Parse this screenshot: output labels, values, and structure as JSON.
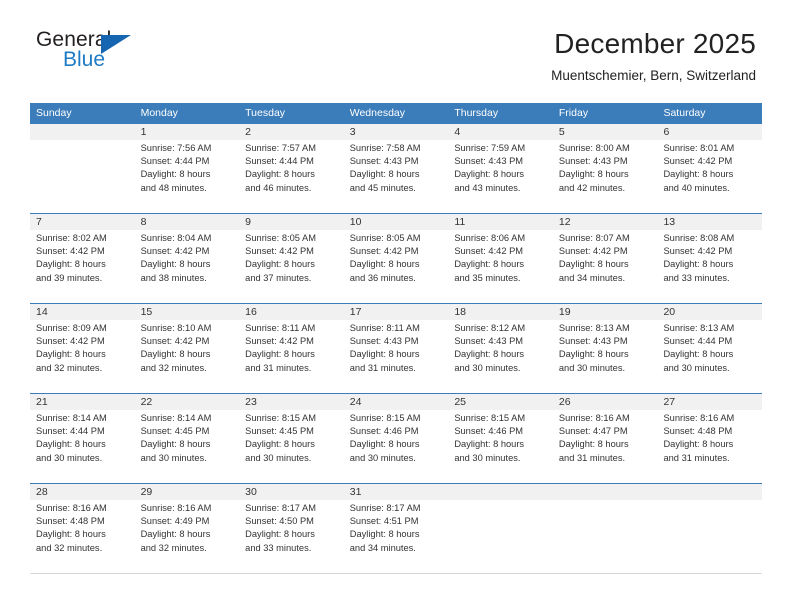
{
  "logo": {
    "primary_text": "General",
    "secondary_text": "Blue",
    "triangle_color": "#1565b0",
    "secondary_color": "#1f7bc4"
  },
  "header": {
    "title": "December 2025",
    "subtitle": "Muentschemier, Bern, Switzerland"
  },
  "theme": {
    "header_blue": "#3b7cba",
    "daynum_band": "#f1f1f1",
    "text": "#333333"
  },
  "calendar": {
    "weekdays": [
      "Sunday",
      "Monday",
      "Tuesday",
      "Wednesday",
      "Thursday",
      "Friday",
      "Saturday"
    ],
    "weeks": [
      [
        {
          "day": "",
          "sunrise": "",
          "sunset": "",
          "daylight_line1": "",
          "daylight_line2": ""
        },
        {
          "day": "1",
          "sunrise": "Sunrise: 7:56 AM",
          "sunset": "Sunset: 4:44 PM",
          "daylight_line1": "Daylight: 8 hours",
          "daylight_line2": "and 48 minutes."
        },
        {
          "day": "2",
          "sunrise": "Sunrise: 7:57 AM",
          "sunset": "Sunset: 4:44 PM",
          "daylight_line1": "Daylight: 8 hours",
          "daylight_line2": "and 46 minutes."
        },
        {
          "day": "3",
          "sunrise": "Sunrise: 7:58 AM",
          "sunset": "Sunset: 4:43 PM",
          "daylight_line1": "Daylight: 8 hours",
          "daylight_line2": "and 45 minutes."
        },
        {
          "day": "4",
          "sunrise": "Sunrise: 7:59 AM",
          "sunset": "Sunset: 4:43 PM",
          "daylight_line1": "Daylight: 8 hours",
          "daylight_line2": "and 43 minutes."
        },
        {
          "day": "5",
          "sunrise": "Sunrise: 8:00 AM",
          "sunset": "Sunset: 4:43 PM",
          "daylight_line1": "Daylight: 8 hours",
          "daylight_line2": "and 42 minutes."
        },
        {
          "day": "6",
          "sunrise": "Sunrise: 8:01 AM",
          "sunset": "Sunset: 4:42 PM",
          "daylight_line1": "Daylight: 8 hours",
          "daylight_line2": "and 40 minutes."
        }
      ],
      [
        {
          "day": "7",
          "sunrise": "Sunrise: 8:02 AM",
          "sunset": "Sunset: 4:42 PM",
          "daylight_line1": "Daylight: 8 hours",
          "daylight_line2": "and 39 minutes."
        },
        {
          "day": "8",
          "sunrise": "Sunrise: 8:04 AM",
          "sunset": "Sunset: 4:42 PM",
          "daylight_line1": "Daylight: 8 hours",
          "daylight_line2": "and 38 minutes."
        },
        {
          "day": "9",
          "sunrise": "Sunrise: 8:05 AM",
          "sunset": "Sunset: 4:42 PM",
          "daylight_line1": "Daylight: 8 hours",
          "daylight_line2": "and 37 minutes."
        },
        {
          "day": "10",
          "sunrise": "Sunrise: 8:05 AM",
          "sunset": "Sunset: 4:42 PM",
          "daylight_line1": "Daylight: 8 hours",
          "daylight_line2": "and 36 minutes."
        },
        {
          "day": "11",
          "sunrise": "Sunrise: 8:06 AM",
          "sunset": "Sunset: 4:42 PM",
          "daylight_line1": "Daylight: 8 hours",
          "daylight_line2": "and 35 minutes."
        },
        {
          "day": "12",
          "sunrise": "Sunrise: 8:07 AM",
          "sunset": "Sunset: 4:42 PM",
          "daylight_line1": "Daylight: 8 hours",
          "daylight_line2": "and 34 minutes."
        },
        {
          "day": "13",
          "sunrise": "Sunrise: 8:08 AM",
          "sunset": "Sunset: 4:42 PM",
          "daylight_line1": "Daylight: 8 hours",
          "daylight_line2": "and 33 minutes."
        }
      ],
      [
        {
          "day": "14",
          "sunrise": "Sunrise: 8:09 AM",
          "sunset": "Sunset: 4:42 PM",
          "daylight_line1": "Daylight: 8 hours",
          "daylight_line2": "and 32 minutes."
        },
        {
          "day": "15",
          "sunrise": "Sunrise: 8:10 AM",
          "sunset": "Sunset: 4:42 PM",
          "daylight_line1": "Daylight: 8 hours",
          "daylight_line2": "and 32 minutes."
        },
        {
          "day": "16",
          "sunrise": "Sunrise: 8:11 AM",
          "sunset": "Sunset: 4:42 PM",
          "daylight_line1": "Daylight: 8 hours",
          "daylight_line2": "and 31 minutes."
        },
        {
          "day": "17",
          "sunrise": "Sunrise: 8:11 AM",
          "sunset": "Sunset: 4:43 PM",
          "daylight_line1": "Daylight: 8 hours",
          "daylight_line2": "and 31 minutes."
        },
        {
          "day": "18",
          "sunrise": "Sunrise: 8:12 AM",
          "sunset": "Sunset: 4:43 PM",
          "daylight_line1": "Daylight: 8 hours",
          "daylight_line2": "and 30 minutes."
        },
        {
          "day": "19",
          "sunrise": "Sunrise: 8:13 AM",
          "sunset": "Sunset: 4:43 PM",
          "daylight_line1": "Daylight: 8 hours",
          "daylight_line2": "and 30 minutes."
        },
        {
          "day": "20",
          "sunrise": "Sunrise: 8:13 AM",
          "sunset": "Sunset: 4:44 PM",
          "daylight_line1": "Daylight: 8 hours",
          "daylight_line2": "and 30 minutes."
        }
      ],
      [
        {
          "day": "21",
          "sunrise": "Sunrise: 8:14 AM",
          "sunset": "Sunset: 4:44 PM",
          "daylight_line1": "Daylight: 8 hours",
          "daylight_line2": "and 30 minutes."
        },
        {
          "day": "22",
          "sunrise": "Sunrise: 8:14 AM",
          "sunset": "Sunset: 4:45 PM",
          "daylight_line1": "Daylight: 8 hours",
          "daylight_line2": "and 30 minutes."
        },
        {
          "day": "23",
          "sunrise": "Sunrise: 8:15 AM",
          "sunset": "Sunset: 4:45 PM",
          "daylight_line1": "Daylight: 8 hours",
          "daylight_line2": "and 30 minutes."
        },
        {
          "day": "24",
          "sunrise": "Sunrise: 8:15 AM",
          "sunset": "Sunset: 4:46 PM",
          "daylight_line1": "Daylight: 8 hours",
          "daylight_line2": "and 30 minutes."
        },
        {
          "day": "25",
          "sunrise": "Sunrise: 8:15 AM",
          "sunset": "Sunset: 4:46 PM",
          "daylight_line1": "Daylight: 8 hours",
          "daylight_line2": "and 30 minutes."
        },
        {
          "day": "26",
          "sunrise": "Sunrise: 8:16 AM",
          "sunset": "Sunset: 4:47 PM",
          "daylight_line1": "Daylight: 8 hours",
          "daylight_line2": "and 31 minutes."
        },
        {
          "day": "27",
          "sunrise": "Sunrise: 8:16 AM",
          "sunset": "Sunset: 4:48 PM",
          "daylight_line1": "Daylight: 8 hours",
          "daylight_line2": "and 31 minutes."
        }
      ],
      [
        {
          "day": "28",
          "sunrise": "Sunrise: 8:16 AM",
          "sunset": "Sunset: 4:48 PM",
          "daylight_line1": "Daylight: 8 hours",
          "daylight_line2": "and 32 minutes."
        },
        {
          "day": "29",
          "sunrise": "Sunrise: 8:16 AM",
          "sunset": "Sunset: 4:49 PM",
          "daylight_line1": "Daylight: 8 hours",
          "daylight_line2": "and 32 minutes."
        },
        {
          "day": "30",
          "sunrise": "Sunrise: 8:17 AM",
          "sunset": "Sunset: 4:50 PM",
          "daylight_line1": "Daylight: 8 hours",
          "daylight_line2": "and 33 minutes."
        },
        {
          "day": "31",
          "sunrise": "Sunrise: 8:17 AM",
          "sunset": "Sunset: 4:51 PM",
          "daylight_line1": "Daylight: 8 hours",
          "daylight_line2": "and 34 minutes."
        },
        {
          "day": "",
          "sunrise": "",
          "sunset": "",
          "daylight_line1": "",
          "daylight_line2": ""
        },
        {
          "day": "",
          "sunrise": "",
          "sunset": "",
          "daylight_line1": "",
          "daylight_line2": ""
        },
        {
          "day": "",
          "sunrise": "",
          "sunset": "",
          "daylight_line1": "",
          "daylight_line2": ""
        }
      ]
    ]
  }
}
